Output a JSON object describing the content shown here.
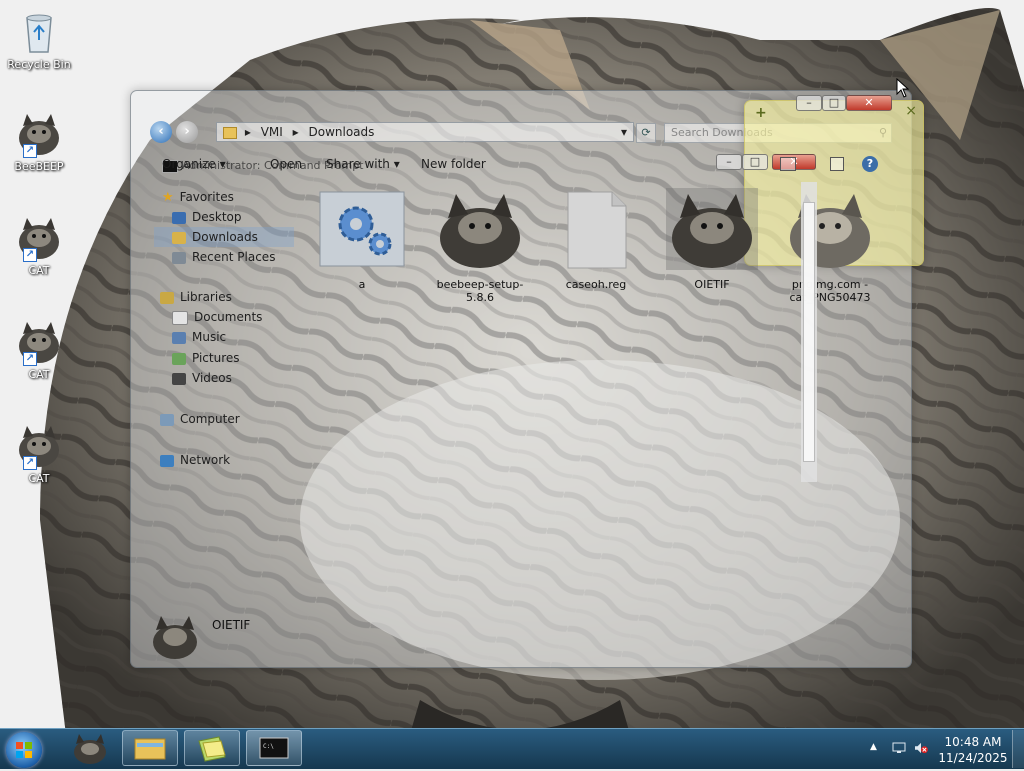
{
  "desktop": {
    "icons": [
      {
        "label": "Recycle Bin",
        "icon": "recycle-bin-icon"
      },
      {
        "label": "BeeBEEP",
        "icon": "cat-icon"
      },
      {
        "label": "CAT",
        "icon": "cat-icon"
      },
      {
        "label": "CAT",
        "icon": "cat-icon"
      },
      {
        "label": "CAT",
        "icon": "cat-icon"
      }
    ]
  },
  "explorer": {
    "address": {
      "root": "VMI",
      "sep": "▸",
      "folder": "Downloads"
    },
    "search_placeholder": "Search Downloads",
    "cmd_title": "Administrator: Command Prompt",
    "toolbar": {
      "organize": "Organize",
      "open": "Open",
      "share": "Share with",
      "new_folder": "New folder"
    },
    "nav": {
      "favorites": "Favorites",
      "desktop": "Desktop",
      "downloads": "Downloads",
      "recent": "Recent Places",
      "libraries": "Libraries",
      "documents": "Documents",
      "music": "Music",
      "pictures": "Pictures",
      "videos": "Videos",
      "computer": "Computer",
      "network": "Network"
    },
    "files": [
      {
        "name": "a",
        "icon": "gears-icon"
      },
      {
        "name": "beebeep-setup-5.8.6",
        "icon": "cat-icon"
      },
      {
        "name": "caseoh.reg",
        "icon": "blank-file-icon"
      },
      {
        "name": "OIETIF",
        "icon": "cat-icon",
        "selected": true
      },
      {
        "name": "pngimg.com - cat_PNG50473",
        "icon": "cat-icon"
      }
    ],
    "details_selected": "OIETIF"
  },
  "sticky": {
    "add": "+",
    "close": "×"
  },
  "taskbar": {
    "time": "10:48 AM",
    "date": "11/24/2025",
    "tray_arrow": "▲"
  },
  "colors": {
    "taskbar": "#1f4a66",
    "selection": "#7aa0d2",
    "close_red": "#c0392b"
  }
}
